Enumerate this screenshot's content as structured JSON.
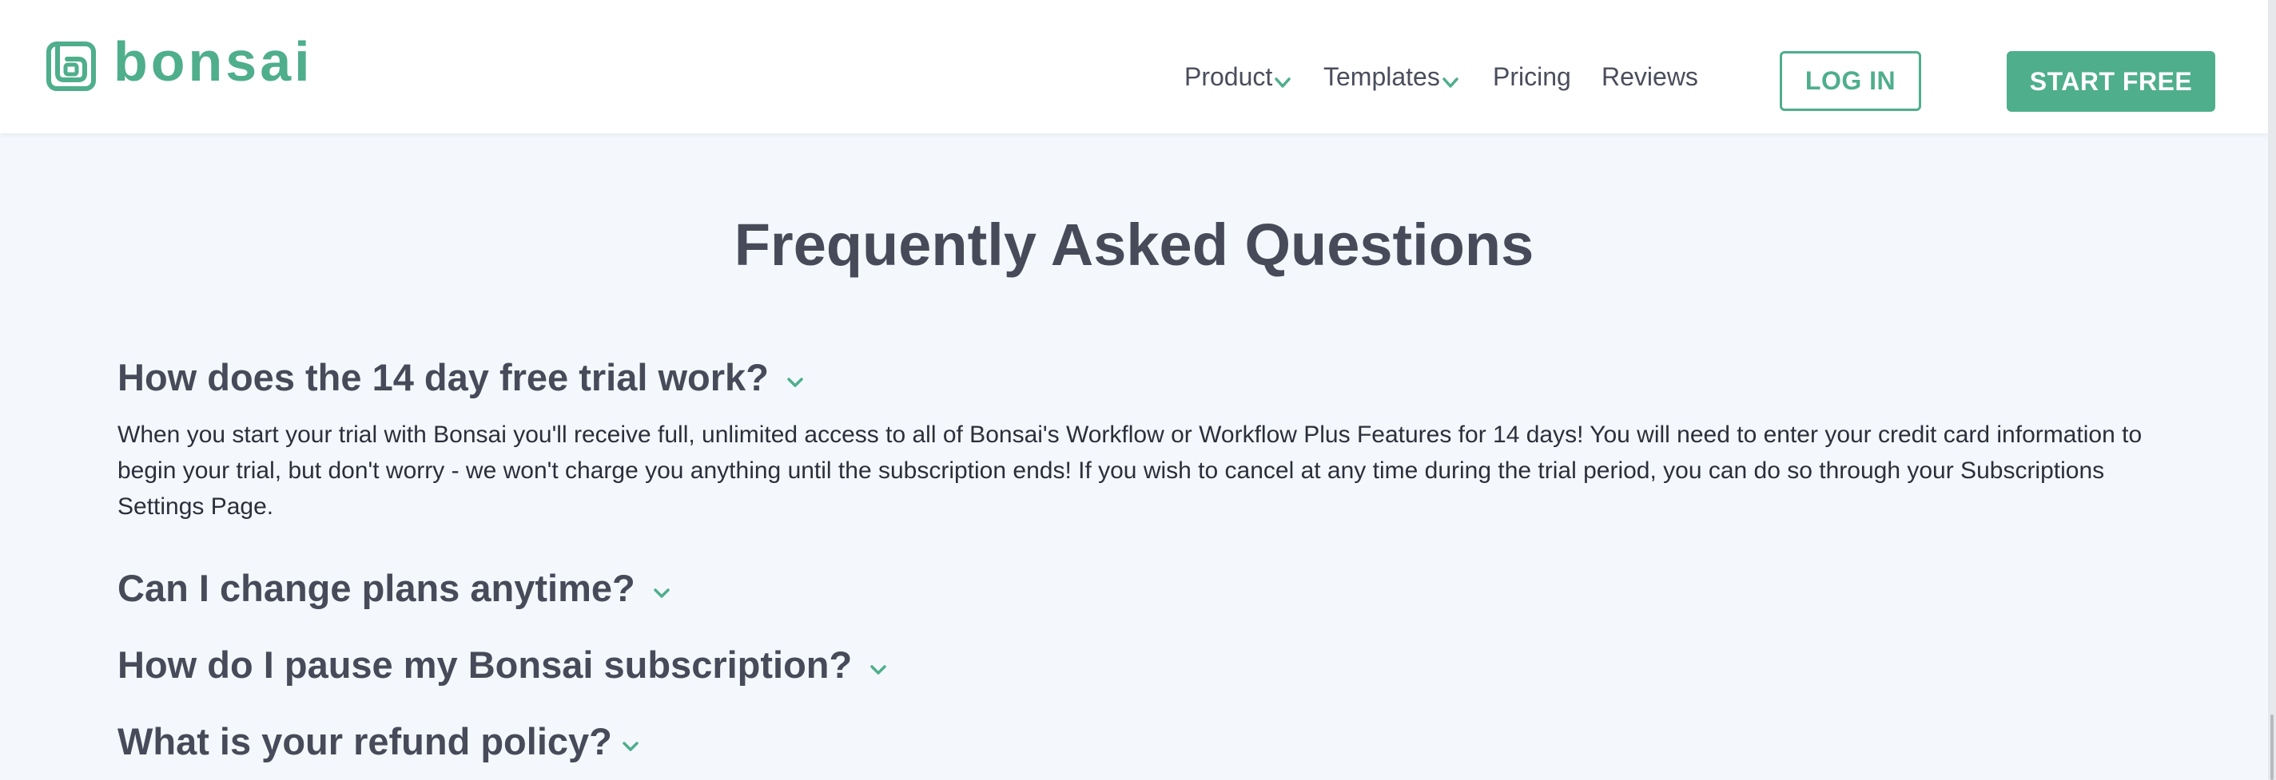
{
  "brand": {
    "name": "bonsai",
    "accent": "#4fae8c"
  },
  "nav": {
    "product": "Product",
    "templates": "Templates",
    "pricing": "Pricing",
    "reviews": "Reviews"
  },
  "auth": {
    "login_label": "LOG IN",
    "start_label": "START FREE"
  },
  "faq": {
    "title": "Frequently Asked Questions",
    "items": [
      {
        "question": "How does the 14 day free trial work?",
        "expanded": true,
        "answer": "When you start your trial with Bonsai you'll receive full, unlimited access to all of Bonsai's Workflow or Workflow Plus Features for 14 days! You will need to enter your credit card information to begin your trial, but don't worry - we won't charge you anything until the subscription ends! If you wish to cancel at any time during the trial period, you can do so through your Subscriptions Settings Page."
      },
      {
        "question": "Can I change plans anytime?",
        "expanded": false
      },
      {
        "question": "How do I pause my Bonsai subscription?",
        "expanded": false
      },
      {
        "question": "What is your refund policy?",
        "expanded": false
      }
    ]
  }
}
